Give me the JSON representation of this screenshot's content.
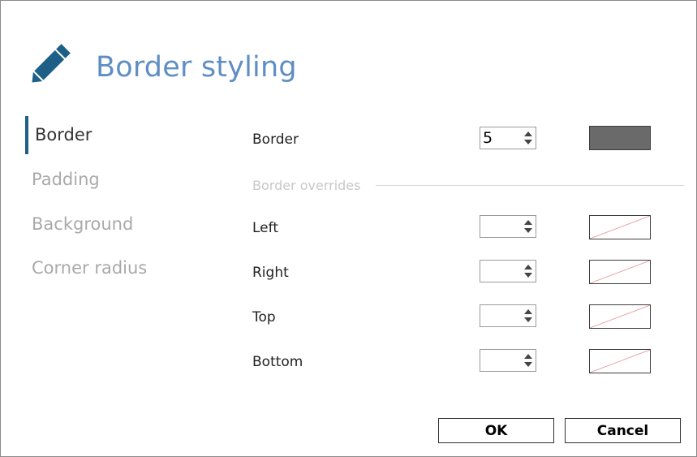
{
  "dialog": {
    "title": "Border styling"
  },
  "nav": {
    "items": [
      {
        "label": "Border",
        "active": true
      },
      {
        "label": "Padding",
        "active": false
      },
      {
        "label": "Background",
        "active": false
      },
      {
        "label": "Corner radius",
        "active": false
      }
    ],
    "accent_color": "#1d5f86"
  },
  "border": {
    "label": "Border",
    "value": "5",
    "swatch_color": "#6a6a6a"
  },
  "overrides": {
    "section_label": "Border overrides",
    "rows": [
      {
        "label": "Left",
        "value": ""
      },
      {
        "label": "Right",
        "value": ""
      },
      {
        "label": "Top",
        "value": ""
      },
      {
        "label": "Bottom",
        "value": ""
      }
    ]
  },
  "buttons": {
    "ok_label": "OK",
    "cancel_label": "Cancel"
  },
  "colors": {
    "title": "#5f8ec4",
    "no_color_line": "#e8a0a8"
  }
}
